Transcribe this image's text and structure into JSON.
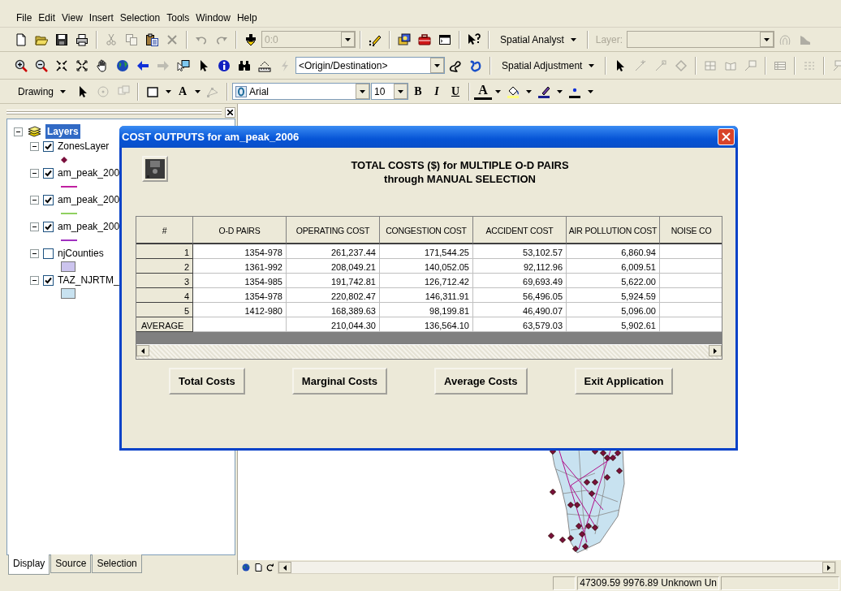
{
  "menu": [
    "File",
    "Edit",
    "View",
    "Insert",
    "Selection",
    "Tools",
    "Window",
    "Help"
  ],
  "toolbars": [
    [
      {
        "kind": "icon",
        "disabled": false
      },
      {
        "kind": "icon",
        "disabled": false
      },
      {
        "kind": "icon",
        "disabled": false
      },
      {
        "kind": "icon",
        "disabled": false
      },
      {
        "kind": "sep"
      },
      {
        "kind": "icon",
        "disabled": true
      },
      {
        "kind": "icon",
        "disabled": true
      },
      {
        "kind": "icon",
        "disabled": false
      },
      {
        "kind": "icon",
        "disabled": true
      },
      {
        "kind": "sep"
      },
      {
        "kind": "icon",
        "disabled": true
      },
      {
        "kind": "icon",
        "disabled": true
      },
      {
        "kind": "sep"
      },
      {
        "kind": "icon",
        "disabled": false
      },
      {
        "kind": "combo",
        "value": "0:0",
        "disabled": true
      },
      {
        "kind": "sep"
      },
      {
        "kind": "icon",
        "disabled": false
      },
      {
        "kind": "sep"
      },
      {
        "kind": "icon",
        "disabled": false
      },
      {
        "kind": "icon",
        "disabled": false
      },
      {
        "kind": "icon",
        "disabled": false
      },
      {
        "kind": "sep"
      },
      {
        "kind": "icon",
        "disabled": false
      },
      {
        "kind": "sep"
      },
      {
        "kind": "menu",
        "label": "Spatial Analyst"
      },
      {
        "kind": "sep"
      },
      {
        "kind": "label",
        "text": "Layer:",
        "disabled": true
      },
      {
        "kind": "combo",
        "disabled": true
      },
      {
        "kind": "icon",
        "disabled": true
      },
      {
        "kind": "icon",
        "disabled": true
      }
    ],
    [
      {
        "kind": "icon",
        "disabled": false
      },
      {
        "kind": "icon",
        "disabled": false
      },
      {
        "kind": "icon",
        "disabled": false
      },
      {
        "kind": "icon",
        "disabled": false
      },
      {
        "kind": "icon",
        "disabled": false
      },
      {
        "kind": "icon",
        "disabled": false
      },
      {
        "kind": "icon",
        "disabled": false
      },
      {
        "kind": "icon",
        "disabled": true
      },
      {
        "kind": "icon",
        "disabled": false
      },
      {
        "kind": "icon",
        "disabled": false
      },
      {
        "kind": "icon",
        "disabled": false
      },
      {
        "kind": "icon",
        "disabled": false
      },
      {
        "kind": "icon",
        "disabled": false
      },
      {
        "kind": "icon",
        "disabled": true
      },
      {
        "kind": "combo",
        "value": "<Origin/Destination>",
        "disabled": false
      },
      {
        "kind": "icon",
        "disabled": false
      },
      {
        "kind": "icon",
        "disabled": false
      },
      {
        "kind": "sep"
      },
      {
        "kind": "menu",
        "label": "Spatial Adjustment"
      },
      {
        "kind": "sep"
      },
      {
        "kind": "icon",
        "disabled": false
      },
      {
        "kind": "icon",
        "disabled": true
      },
      {
        "kind": "icon",
        "disabled": true
      },
      {
        "kind": "icon",
        "disabled": true
      },
      {
        "kind": "sep"
      },
      {
        "kind": "icon",
        "disabled": true
      },
      {
        "kind": "icon",
        "disabled": true
      },
      {
        "kind": "icon",
        "disabled": true
      },
      {
        "kind": "sep"
      },
      {
        "kind": "icon",
        "disabled": true
      },
      {
        "kind": "sep"
      },
      {
        "kind": "icon",
        "disabled": true
      },
      {
        "kind": "sep"
      },
      {
        "kind": "icon",
        "disabled": true
      }
    ],
    [
      {
        "kind": "menu",
        "label": "Drawing"
      },
      {
        "kind": "icon",
        "disabled": false
      },
      {
        "kind": "icon",
        "disabled": true
      },
      {
        "kind": "icon",
        "disabled": true
      },
      {
        "kind": "sep"
      },
      {
        "kind": "icon",
        "disabled": false
      },
      {
        "kind": "caret"
      },
      {
        "kind": "glyph",
        "text": "A"
      },
      {
        "kind": "caret"
      },
      {
        "kind": "icon",
        "disabled": true
      },
      {
        "kind": "sep"
      },
      {
        "kind": "font",
        "value": "Arial"
      },
      {
        "kind": "combo",
        "value": "10",
        "disabled": false
      },
      {
        "kind": "bold",
        "text": "B"
      },
      {
        "kind": "italic",
        "text": "I"
      },
      {
        "kind": "underline",
        "text": "U"
      },
      {
        "kind": "sep"
      },
      {
        "kind": "color-glyph",
        "text": "A"
      },
      {
        "kind": "caret"
      },
      {
        "kind": "icon",
        "disabled": false
      },
      {
        "kind": "caret"
      },
      {
        "kind": "icon",
        "disabled": false
      },
      {
        "kind": "caret"
      },
      {
        "kind": "icon",
        "disabled": false
      },
      {
        "kind": "caret"
      }
    ]
  ],
  "toc": {
    "root": {
      "label": "Layers",
      "selected": true,
      "expanded": true,
      "children": [
        {
          "name": "ZonesLayer",
          "checked": true,
          "expanded": true,
          "legend": {
            "kind": "point",
            "color": "#7a0f3c"
          }
        },
        {
          "name": "am_peak_200",
          "checked": true,
          "expanded": true,
          "legend": {
            "kind": "line",
            "color": "#c020a0"
          }
        },
        {
          "name": "am_peak_200",
          "checked": true,
          "expanded": true,
          "legend": {
            "kind": "line",
            "color": "#90d060"
          }
        },
        {
          "name": "am_peak_200",
          "checked": true,
          "expanded": true,
          "legend": {
            "kind": "line",
            "color": "#a030c0"
          }
        },
        {
          "name": "njCounties",
          "checked": false,
          "expanded": true,
          "legend": {
            "kind": "fill",
            "color": "#ccc4ee"
          }
        },
        {
          "name": "TAZ_NJRTM_",
          "checked": true,
          "expanded": true,
          "legend": {
            "kind": "fill",
            "color": "#c8e2f0"
          }
        }
      ]
    }
  },
  "toc_tabs": [
    {
      "label": "Display",
      "selected": true
    },
    {
      "label": "Source",
      "selected": false
    },
    {
      "label": "Selection",
      "selected": false
    }
  ],
  "dialog": {
    "title": "COST OUTPUTS for am_peak_2006",
    "heading": [
      "TOTAL COSTS ($) for MULTIPLE O-D PAIRS",
      "through MANUAL SELECTION"
    ],
    "table": {
      "columns": [
        "#",
        "O-D PAIRS",
        "OPERATING COST",
        "CONGESTION COST",
        "ACCIDENT COST",
        "AIR POLLUTION COST",
        "NOISE CO"
      ],
      "rows": [
        {
          "cells": [
            "1",
            "1354-978",
            "261,237.44",
            "171,544.25",
            "53,102.57",
            "6,860.94",
            ""
          ]
        },
        {
          "cells": [
            "2",
            "1361-992",
            "208,049.21",
            "140,052.05",
            "92,112.96",
            "6,009.51",
            ""
          ]
        },
        {
          "cells": [
            "3",
            "1354-985",
            "191,742.81",
            "126,712.42",
            "69,693.49",
            "5,622.00",
            ""
          ]
        },
        {
          "cells": [
            "4",
            "1354-978",
            "220,802.47",
            "146,311.91",
            "56,496.05",
            "5,924.59",
            ""
          ]
        },
        {
          "cells": [
            "5",
            "1412-980",
            "168,389.63",
            "98,199.81",
            "46,490.07",
            "5,096.00",
            ""
          ]
        },
        {
          "cells": [
            "AVERAGE",
            "",
            "210,044.30",
            "136,564.10",
            "63,579.03",
            "5,902.61",
            ""
          ]
        }
      ]
    },
    "buttons": [
      "Total Costs",
      "Marginal Costs",
      "Average Costs",
      "Exit Application"
    ]
  },
  "status_bar": {
    "coordinates": "47309.59  9976.89 Unknown Un"
  }
}
